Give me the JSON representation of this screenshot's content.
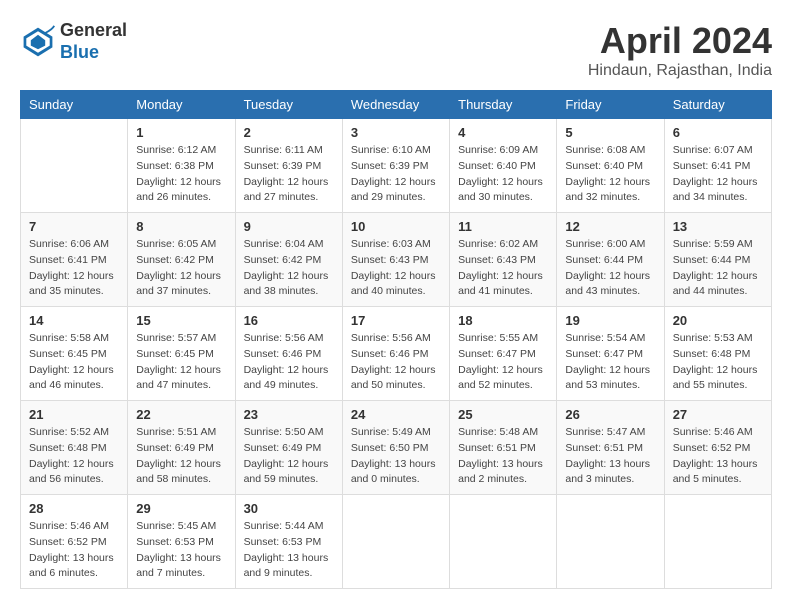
{
  "header": {
    "logo_general": "General",
    "logo_blue": "Blue",
    "month_title": "April 2024",
    "location": "Hindaun, Rajasthan, India"
  },
  "days_of_week": [
    "Sunday",
    "Monday",
    "Tuesday",
    "Wednesday",
    "Thursday",
    "Friday",
    "Saturday"
  ],
  "weeks": [
    [
      {
        "day": "",
        "info": ""
      },
      {
        "day": "1",
        "info": "Sunrise: 6:12 AM\nSunset: 6:38 PM\nDaylight: 12 hours\nand 26 minutes."
      },
      {
        "day": "2",
        "info": "Sunrise: 6:11 AM\nSunset: 6:39 PM\nDaylight: 12 hours\nand 27 minutes."
      },
      {
        "day": "3",
        "info": "Sunrise: 6:10 AM\nSunset: 6:39 PM\nDaylight: 12 hours\nand 29 minutes."
      },
      {
        "day": "4",
        "info": "Sunrise: 6:09 AM\nSunset: 6:40 PM\nDaylight: 12 hours\nand 30 minutes."
      },
      {
        "day": "5",
        "info": "Sunrise: 6:08 AM\nSunset: 6:40 PM\nDaylight: 12 hours\nand 32 minutes."
      },
      {
        "day": "6",
        "info": "Sunrise: 6:07 AM\nSunset: 6:41 PM\nDaylight: 12 hours\nand 34 minutes."
      }
    ],
    [
      {
        "day": "7",
        "info": "Sunrise: 6:06 AM\nSunset: 6:41 PM\nDaylight: 12 hours\nand 35 minutes."
      },
      {
        "day": "8",
        "info": "Sunrise: 6:05 AM\nSunset: 6:42 PM\nDaylight: 12 hours\nand 37 minutes."
      },
      {
        "day": "9",
        "info": "Sunrise: 6:04 AM\nSunset: 6:42 PM\nDaylight: 12 hours\nand 38 minutes."
      },
      {
        "day": "10",
        "info": "Sunrise: 6:03 AM\nSunset: 6:43 PM\nDaylight: 12 hours\nand 40 minutes."
      },
      {
        "day": "11",
        "info": "Sunrise: 6:02 AM\nSunset: 6:43 PM\nDaylight: 12 hours\nand 41 minutes."
      },
      {
        "day": "12",
        "info": "Sunrise: 6:00 AM\nSunset: 6:44 PM\nDaylight: 12 hours\nand 43 minutes."
      },
      {
        "day": "13",
        "info": "Sunrise: 5:59 AM\nSunset: 6:44 PM\nDaylight: 12 hours\nand 44 minutes."
      }
    ],
    [
      {
        "day": "14",
        "info": "Sunrise: 5:58 AM\nSunset: 6:45 PM\nDaylight: 12 hours\nand 46 minutes."
      },
      {
        "day": "15",
        "info": "Sunrise: 5:57 AM\nSunset: 6:45 PM\nDaylight: 12 hours\nand 47 minutes."
      },
      {
        "day": "16",
        "info": "Sunrise: 5:56 AM\nSunset: 6:46 PM\nDaylight: 12 hours\nand 49 minutes."
      },
      {
        "day": "17",
        "info": "Sunrise: 5:56 AM\nSunset: 6:46 PM\nDaylight: 12 hours\nand 50 minutes."
      },
      {
        "day": "18",
        "info": "Sunrise: 5:55 AM\nSunset: 6:47 PM\nDaylight: 12 hours\nand 52 minutes."
      },
      {
        "day": "19",
        "info": "Sunrise: 5:54 AM\nSunset: 6:47 PM\nDaylight: 12 hours\nand 53 minutes."
      },
      {
        "day": "20",
        "info": "Sunrise: 5:53 AM\nSunset: 6:48 PM\nDaylight: 12 hours\nand 55 minutes."
      }
    ],
    [
      {
        "day": "21",
        "info": "Sunrise: 5:52 AM\nSunset: 6:48 PM\nDaylight: 12 hours\nand 56 minutes."
      },
      {
        "day": "22",
        "info": "Sunrise: 5:51 AM\nSunset: 6:49 PM\nDaylight: 12 hours\nand 58 minutes."
      },
      {
        "day": "23",
        "info": "Sunrise: 5:50 AM\nSunset: 6:49 PM\nDaylight: 12 hours\nand 59 minutes."
      },
      {
        "day": "24",
        "info": "Sunrise: 5:49 AM\nSunset: 6:50 PM\nDaylight: 13 hours\nand 0 minutes."
      },
      {
        "day": "25",
        "info": "Sunrise: 5:48 AM\nSunset: 6:51 PM\nDaylight: 13 hours\nand 2 minutes."
      },
      {
        "day": "26",
        "info": "Sunrise: 5:47 AM\nSunset: 6:51 PM\nDaylight: 13 hours\nand 3 minutes."
      },
      {
        "day": "27",
        "info": "Sunrise: 5:46 AM\nSunset: 6:52 PM\nDaylight: 13 hours\nand 5 minutes."
      }
    ],
    [
      {
        "day": "28",
        "info": "Sunrise: 5:46 AM\nSunset: 6:52 PM\nDaylight: 13 hours\nand 6 minutes."
      },
      {
        "day": "29",
        "info": "Sunrise: 5:45 AM\nSunset: 6:53 PM\nDaylight: 13 hours\nand 7 minutes."
      },
      {
        "day": "30",
        "info": "Sunrise: 5:44 AM\nSunset: 6:53 PM\nDaylight: 13 hours\nand 9 minutes."
      },
      {
        "day": "",
        "info": ""
      },
      {
        "day": "",
        "info": ""
      },
      {
        "day": "",
        "info": ""
      },
      {
        "day": "",
        "info": ""
      }
    ]
  ]
}
